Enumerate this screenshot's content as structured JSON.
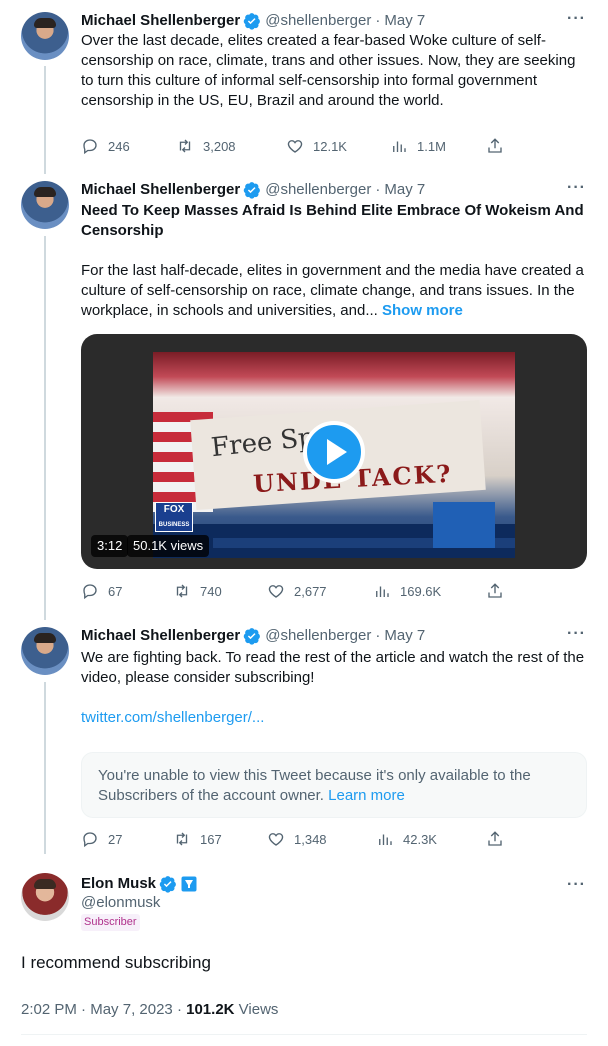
{
  "tweet1": {
    "name": "Michael Shellenberger",
    "handle": "@shellenberger",
    "dot": "·",
    "date": "May 7",
    "text": "Over the last decade, elites created a fear-based Woke culture of self-censorship on race, climate, trans and other issues. Now, they are seeking to turn this culture of informal self-censorship into formal government censorship in the US, EU, Brazil and around the world.",
    "replies": "246",
    "retweets": "3,208",
    "likes": "12.1K",
    "views": "1.1M"
  },
  "tweet2": {
    "name": "Michael Shellenberger",
    "handle": "@shellenberger",
    "dot": "·",
    "date": "May 7",
    "headline": "Need To Keep Masses Afraid Is Behind Elite Embrace Of Wokeism And Censorship",
    "text": "For the last half-decade, elites in government and the media have created a culture of self-censorship on race, climate change, and trans issues. In the workplace, in schools and universities, and...",
    "show_more": "Show more",
    "video_duration": "3:12",
    "video_views": "50.1K views",
    "video_overlay": {
      "free_speech": "Free Spe",
      "under_attack": "UNDE  TACK?",
      "fox": "FOX",
      "fox_sub": "BUSINESS"
    },
    "replies": "67",
    "retweets": "740",
    "likes": "2,677",
    "views": "169.6K"
  },
  "tweet3": {
    "name": "Michael Shellenberger",
    "handle": "@shellenberger",
    "dot": "·",
    "date": "May 7",
    "text": "We are fighting back. To read the rest of the article and watch the rest of the video, please consider subscribing!",
    "link": "twitter.com/shellenberger/...",
    "sub_notice": "You're unable to view this Tweet because it's only available to the Subscribers of the account owner.",
    "learn_more": "Learn more",
    "replies": "27",
    "retweets": "167",
    "likes": "1,348",
    "views": "42.3K"
  },
  "main": {
    "name": "Elon Musk",
    "handle": "@elonmusk",
    "badge": "Subscriber",
    "text": "I recommend subscribing",
    "time": "2:02 PM",
    "dot1": "·",
    "date": "May 7, 2023",
    "dot2": "·",
    "views_count": "101.2K",
    "views_label": "Views"
  },
  "more_label": "···",
  "colors": {
    "accent": "#1d9bf0",
    "secondary_text": "#536471",
    "gold": "#e2b719"
  }
}
